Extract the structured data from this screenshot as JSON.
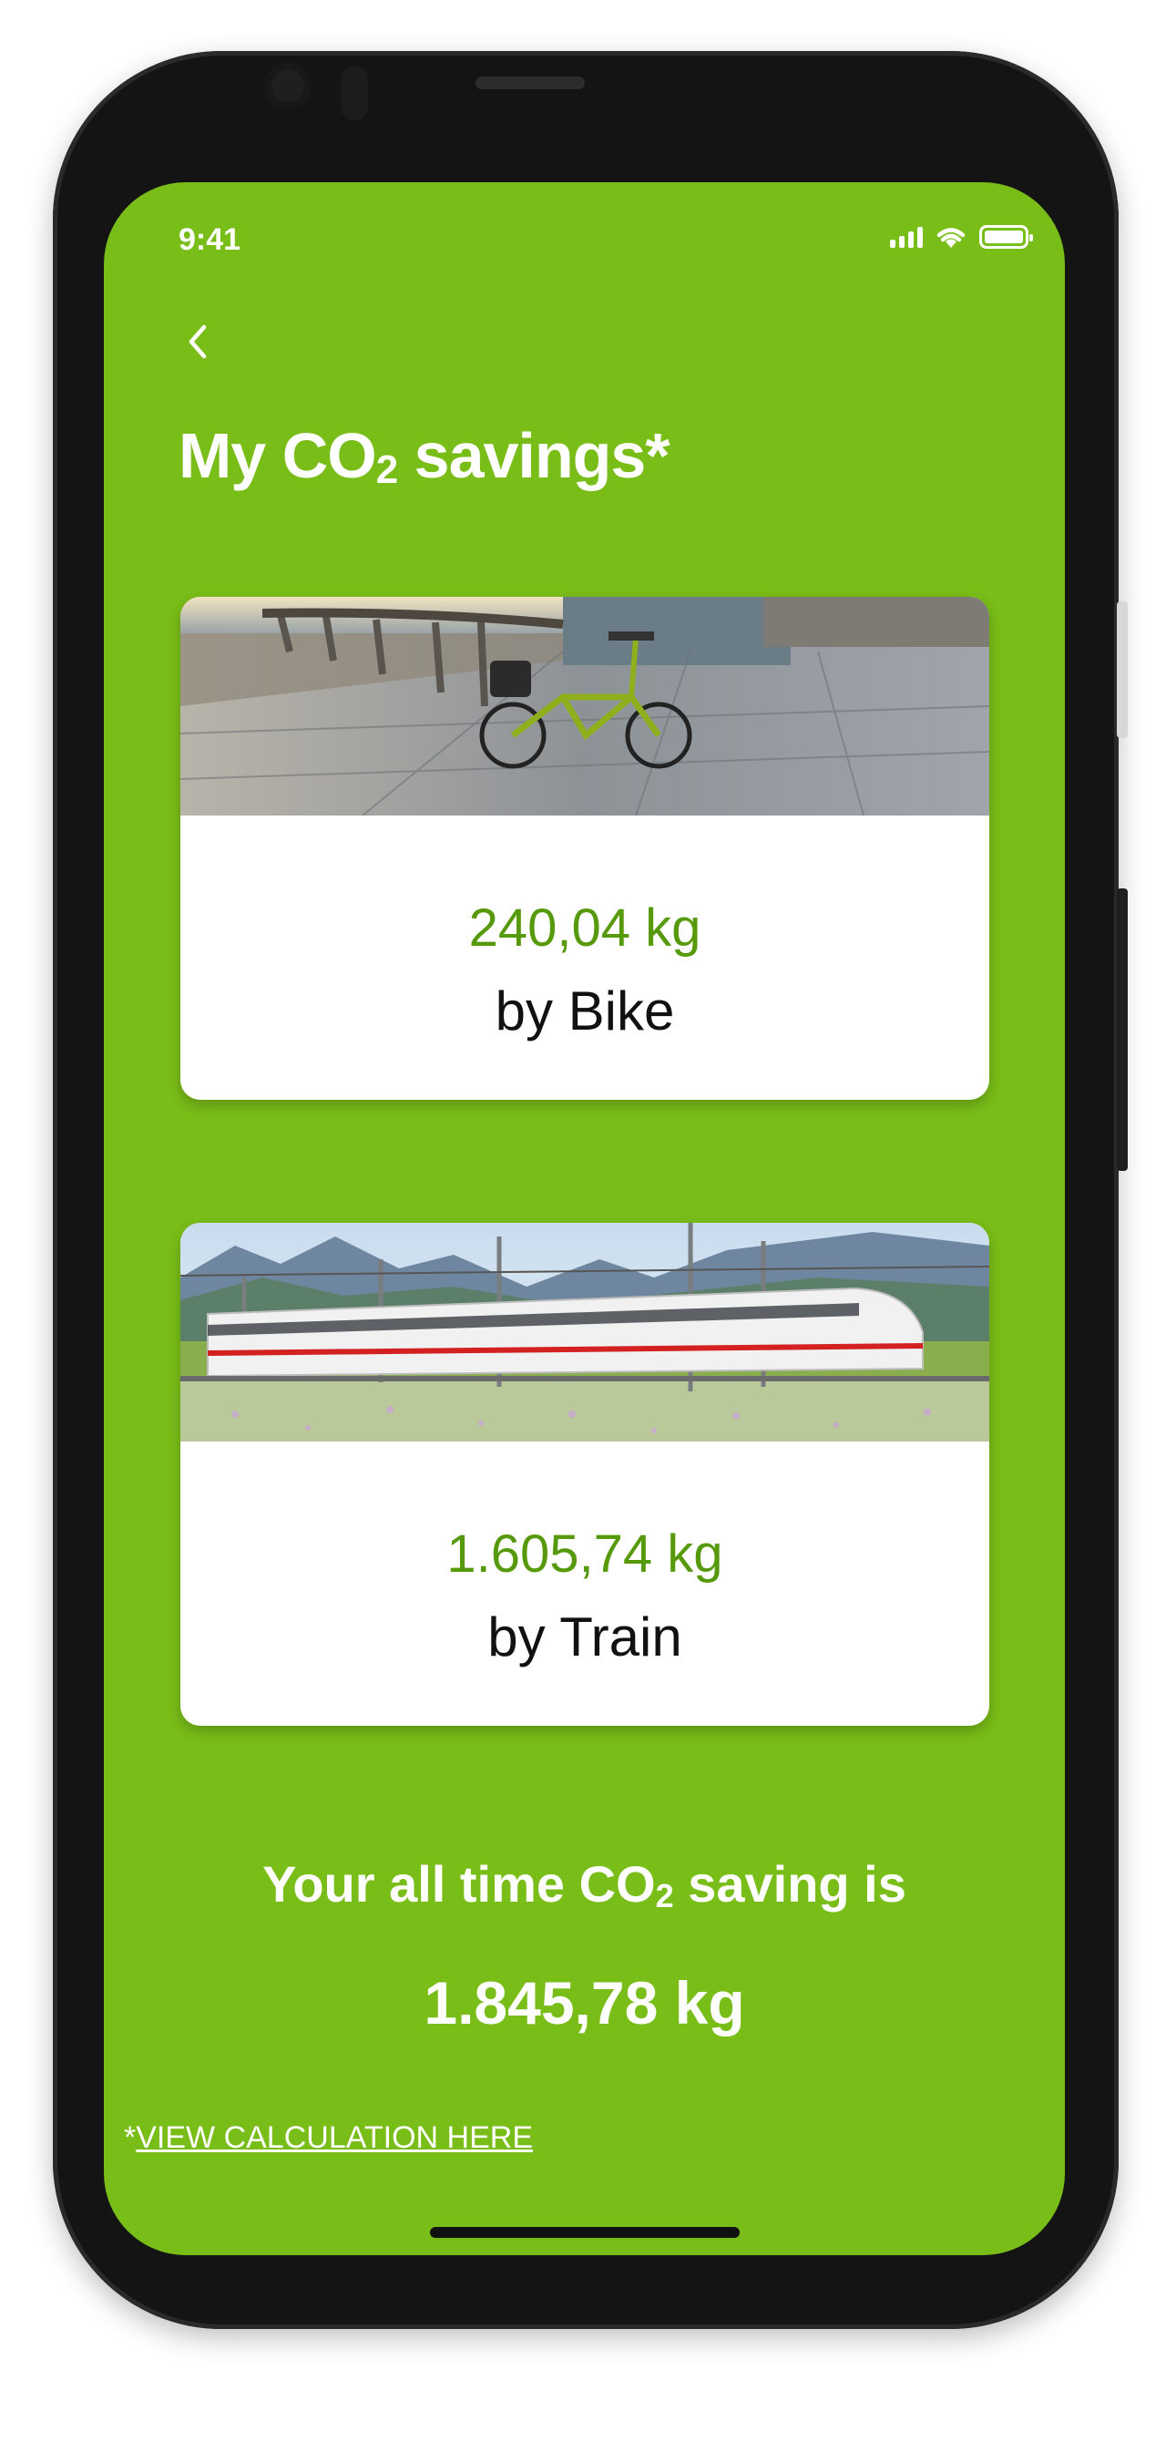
{
  "status_bar": {
    "time": "9:41"
  },
  "header": {
    "back_icon": "chevron-left-icon",
    "title_prefix": "My CO",
    "title_sub": "2",
    "title_suffix": " savings*"
  },
  "cards": [
    {
      "id": "bike",
      "value": "240,04 kg",
      "label": "by Bike",
      "image": "folding-bike-on-pier-photo"
    },
    {
      "id": "train",
      "value": "1.605,74 kg",
      "label": "by Train",
      "image": "high-speed-train-in-mountains-photo"
    }
  ],
  "summary": {
    "label_prefix": "Your all time CO",
    "label_sub": "2",
    "label_suffix": " saving is",
    "total": "1.845,78 kg"
  },
  "footer": {
    "asterisk": "*",
    "link_text": "VIEW CALCULATION HERE"
  },
  "colors": {
    "background": "#79bd18",
    "value_green": "#569a0b",
    "card_bg": "#ffffff",
    "text_white": "#ffffff"
  }
}
